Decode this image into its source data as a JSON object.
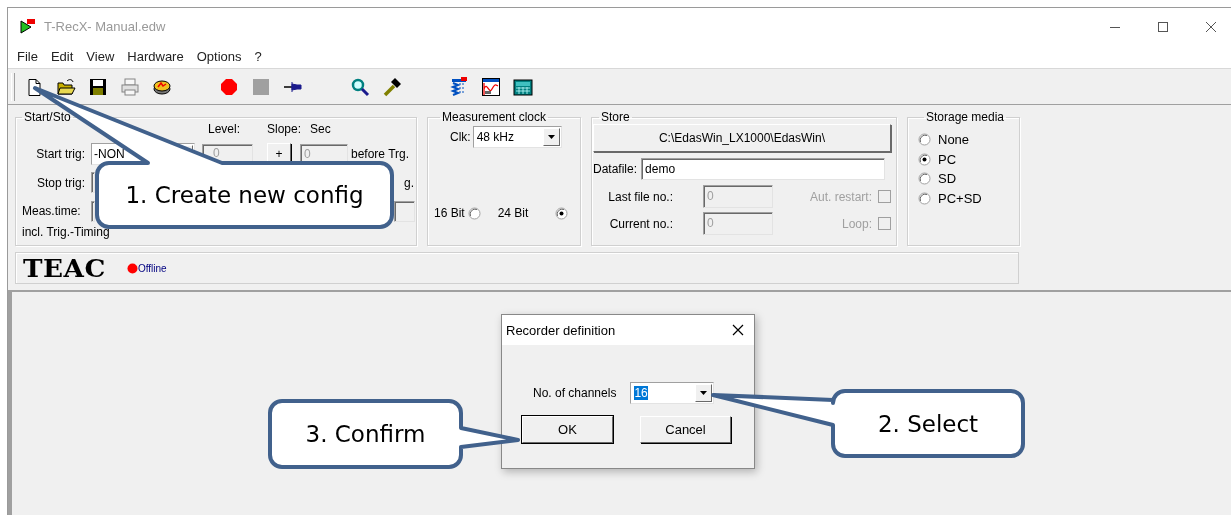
{
  "window": {
    "title": "T-RecX- Manual.edw"
  },
  "menu": [
    "File",
    "Edit",
    "View",
    "Hardware",
    "Options",
    "?"
  ],
  "toolbar": [
    [
      {
        "kind": "new",
        "disabled": false
      },
      {
        "kind": "open",
        "disabled": false
      },
      {
        "kind": "save",
        "disabled": false
      },
      {
        "kind": "print",
        "disabled": true
      },
      {
        "kind": "device",
        "disabled": false
      }
    ],
    [
      {
        "kind": "record",
        "disabled": false
      },
      {
        "kind": "stop",
        "disabled": false
      },
      {
        "kind": "pin",
        "disabled": false
      }
    ],
    [
      {
        "kind": "search",
        "disabled": false
      },
      {
        "kind": "hammer",
        "disabled": false
      }
    ],
    [
      {
        "kind": "signal",
        "disabled": false
      },
      {
        "kind": "chart",
        "disabled": false
      },
      {
        "kind": "keypad",
        "disabled": false
      }
    ]
  ],
  "start_stop": {
    "legend": "Start/Sto",
    "headers": [
      "Level:",
      "Slope:",
      "Sec"
    ],
    "start_trig": {
      "label": "Start trig:",
      "value": "-NON",
      "level_value": "0",
      "slope": "+",
      "sec": "0",
      "suffix": "before Trg."
    },
    "stop_trig": {
      "label": "Stop trig:",
      "suffix": "g."
    },
    "meas_time": {
      "label": "Meas.time:"
    },
    "note": "incl. Trig.-Timing"
  },
  "measurement_clock": {
    "legend": "Measurement clock",
    "clk_label": "Clk:",
    "clk_value": "48 kHz",
    "resolutions": [
      {
        "label": "16 Bit",
        "selected": false
      },
      {
        "label": "24 Bit",
        "selected": true
      }
    ]
  },
  "store": {
    "legend": "Store",
    "path": "C:\\EdasWin_LX1000\\EdasWin\\",
    "datafile_label": "Datafile:",
    "datafile": "demo",
    "numbers": [
      {
        "label": "Last file no.:",
        "value": "0",
        "disabled": true,
        "option": {
          "label": "Aut. restart:",
          "checked": false,
          "disabled": true
        }
      },
      {
        "label": "Current no.:",
        "value": "0",
        "disabled": true,
        "option": {
          "label": "Loop:",
          "checked": false,
          "disabled": true
        }
      }
    ]
  },
  "storage_media": {
    "legend": "Storage media",
    "options": [
      {
        "label": "None",
        "selected": false
      },
      {
        "label": "PC",
        "selected": true
      },
      {
        "label": "SD",
        "selected": false
      },
      {
        "label": "PC+SD",
        "selected": false
      }
    ]
  },
  "brand": "TEAC",
  "status": {
    "text": "Offline",
    "online": false
  },
  "dialog": {
    "title": "Recorder definition",
    "channels_label": "No. of channels",
    "channels_value": "16",
    "value_highlighted": true,
    "buttons": [
      {
        "label": "OK",
        "default": true
      },
      {
        "label": "Cancel",
        "default": false
      }
    ]
  },
  "callouts": [
    {
      "text": "1. Create new config"
    },
    {
      "text": "2. Select"
    },
    {
      "text": "3. Confirm"
    }
  ]
}
